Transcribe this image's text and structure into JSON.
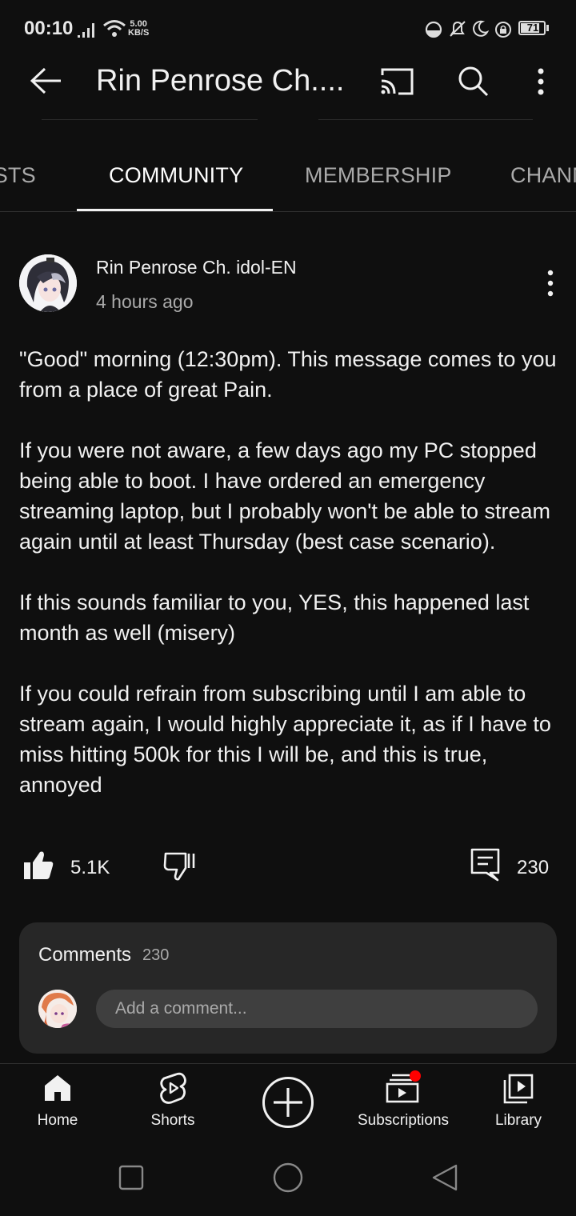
{
  "status_bar": {
    "time": "00:10",
    "net_speed_value": "5.00",
    "net_speed_unit": "KB/S",
    "battery": "71"
  },
  "header": {
    "title": "Rin Penrose Ch....",
    "back_icon": "arrow-left-icon",
    "cast_icon": "cast-icon",
    "search_icon": "search-icon",
    "menu_icon": "more-vertical-icon"
  },
  "tabs": [
    {
      "label": "ISTS"
    },
    {
      "label": "COMMUNITY",
      "active": true
    },
    {
      "label": "MEMBERSHIP"
    },
    {
      "label": "CHANN"
    }
  ],
  "post": {
    "author": "Rin Penrose Ch. idol-EN",
    "time_ago": "4 hours ago",
    "paragraphs": [
      "\"Good\" morning (12:30pm). This message comes to you from a place of great Pain.",
      "If you were not aware, a few days ago my PC stopped being able to boot. I have ordered an emergency streaming laptop, but I probably won't be able to stream again until at least Thursday (best case scenario).",
      "If this sounds familiar to you, YES, this happened last month as well (misery)",
      "If you could refrain from subscribing until I am able to stream again, I would highly appreciate it, as if I have to miss hitting 500k for this I will be, and this is true, annoyed"
    ],
    "likes": "5.1K",
    "comments_count": "230"
  },
  "comments_box": {
    "title": "Comments",
    "count": "230",
    "placeholder": "Add a comment..."
  },
  "bottom_nav": [
    {
      "label": "Home",
      "icon": "home-icon"
    },
    {
      "label": "Shorts",
      "icon": "shorts-icon"
    },
    {
      "label": "",
      "icon": "create-plus-icon"
    },
    {
      "label": "Subscriptions",
      "icon": "subscriptions-icon"
    },
    {
      "label": "Library",
      "icon": "library-icon"
    }
  ],
  "colors": {
    "background": "#0f0f0f",
    "text": "#f1f1f1",
    "secondary_text": "#aaaaaa",
    "card": "#272727",
    "notification_dot": "#ff0000"
  }
}
